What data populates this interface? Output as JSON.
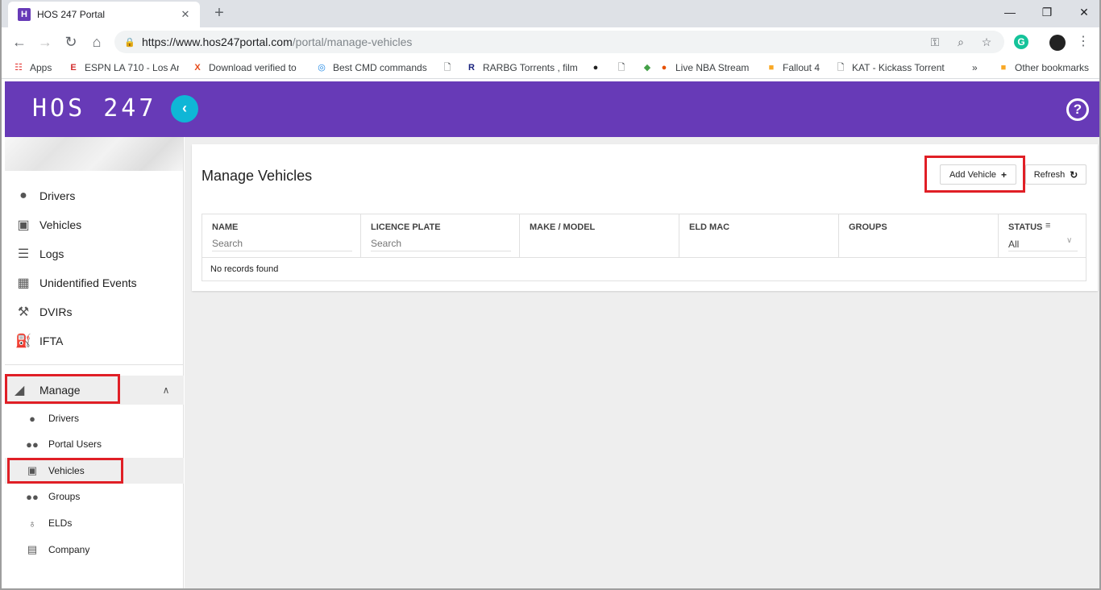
{
  "browser": {
    "tab_title": "HOS 247 Portal",
    "favicon_letter": "H",
    "tab_close": "✕",
    "new_tab": "+",
    "url_host": "https://www.hos247portal.com",
    "url_path": "/portal/manage-vehicles",
    "extension_g": "G"
  },
  "bookmarks": [
    {
      "label": "Apps",
      "icon": "apps-grid-icon"
    },
    {
      "label": "ESPN LA 710 - Los Ar",
      "icon": "espn-icon"
    },
    {
      "label": "Download verified to",
      "icon": "x-icon"
    },
    {
      "label": "Best CMD commands",
      "icon": "cmd-icon"
    },
    {
      "label": "",
      "icon": "page-icon"
    },
    {
      "label": "RARBG Torrents , film",
      "icon": "rarbg-icon"
    },
    {
      "label": "",
      "icon": "spotify-icon"
    },
    {
      "label": "",
      "icon": "page-icon"
    },
    {
      "label": "Live NBA Stream",
      "icon": "nba-icon"
    },
    {
      "label": "Fallout 4",
      "icon": "folder-icon"
    },
    {
      "label": "KAT - Kickass Torrent",
      "icon": "page-icon"
    },
    {
      "label": "»",
      "icon": ""
    },
    {
      "label": "Other bookmarks",
      "icon": "folder-icon"
    }
  ],
  "app": {
    "logo": "HOS 247",
    "collapse_glyph": "‹",
    "help_glyph": "?"
  },
  "sidebar": {
    "items": [
      {
        "label": "Drivers",
        "icon": "person-icon"
      },
      {
        "label": "Vehicles",
        "icon": "bus-icon"
      },
      {
        "label": "Logs",
        "icon": "list-icon"
      },
      {
        "label": "Unidentified Events",
        "icon": "calendar-icon"
      },
      {
        "label": "DVIRs",
        "icon": "wrench-icon"
      },
      {
        "label": "IFTA",
        "icon": "fuel-icon"
      }
    ],
    "manage": {
      "label": "Manage",
      "icon": "manage-icon"
    },
    "subitems": [
      {
        "label": "Drivers",
        "icon": "person-icon"
      },
      {
        "label": "Portal Users",
        "icon": "people-icon"
      },
      {
        "label": "Vehicles",
        "icon": "bus-icon",
        "active": true
      },
      {
        "label": "Groups",
        "icon": "group-icon"
      },
      {
        "label": "ELDs",
        "icon": "antenna-icon"
      },
      {
        "label": "Company",
        "icon": "building-icon"
      }
    ]
  },
  "main": {
    "title": "Manage Vehicles",
    "add_button": "Add Vehicle",
    "refresh_button": "Refresh",
    "columns": [
      {
        "header": "NAME",
        "filter": "Search"
      },
      {
        "header": "LICENCE PLATE",
        "filter": "Search"
      },
      {
        "header": "MAKE / MODEL"
      },
      {
        "header": "ELD MAC"
      },
      {
        "header": "GROUPS"
      },
      {
        "header": "STATUS",
        "select_value": "All"
      }
    ],
    "empty_text": "No records found"
  },
  "colors": {
    "header": "#673ab7",
    "accent": "#0fb6d6",
    "highlight": "#e01f26"
  }
}
